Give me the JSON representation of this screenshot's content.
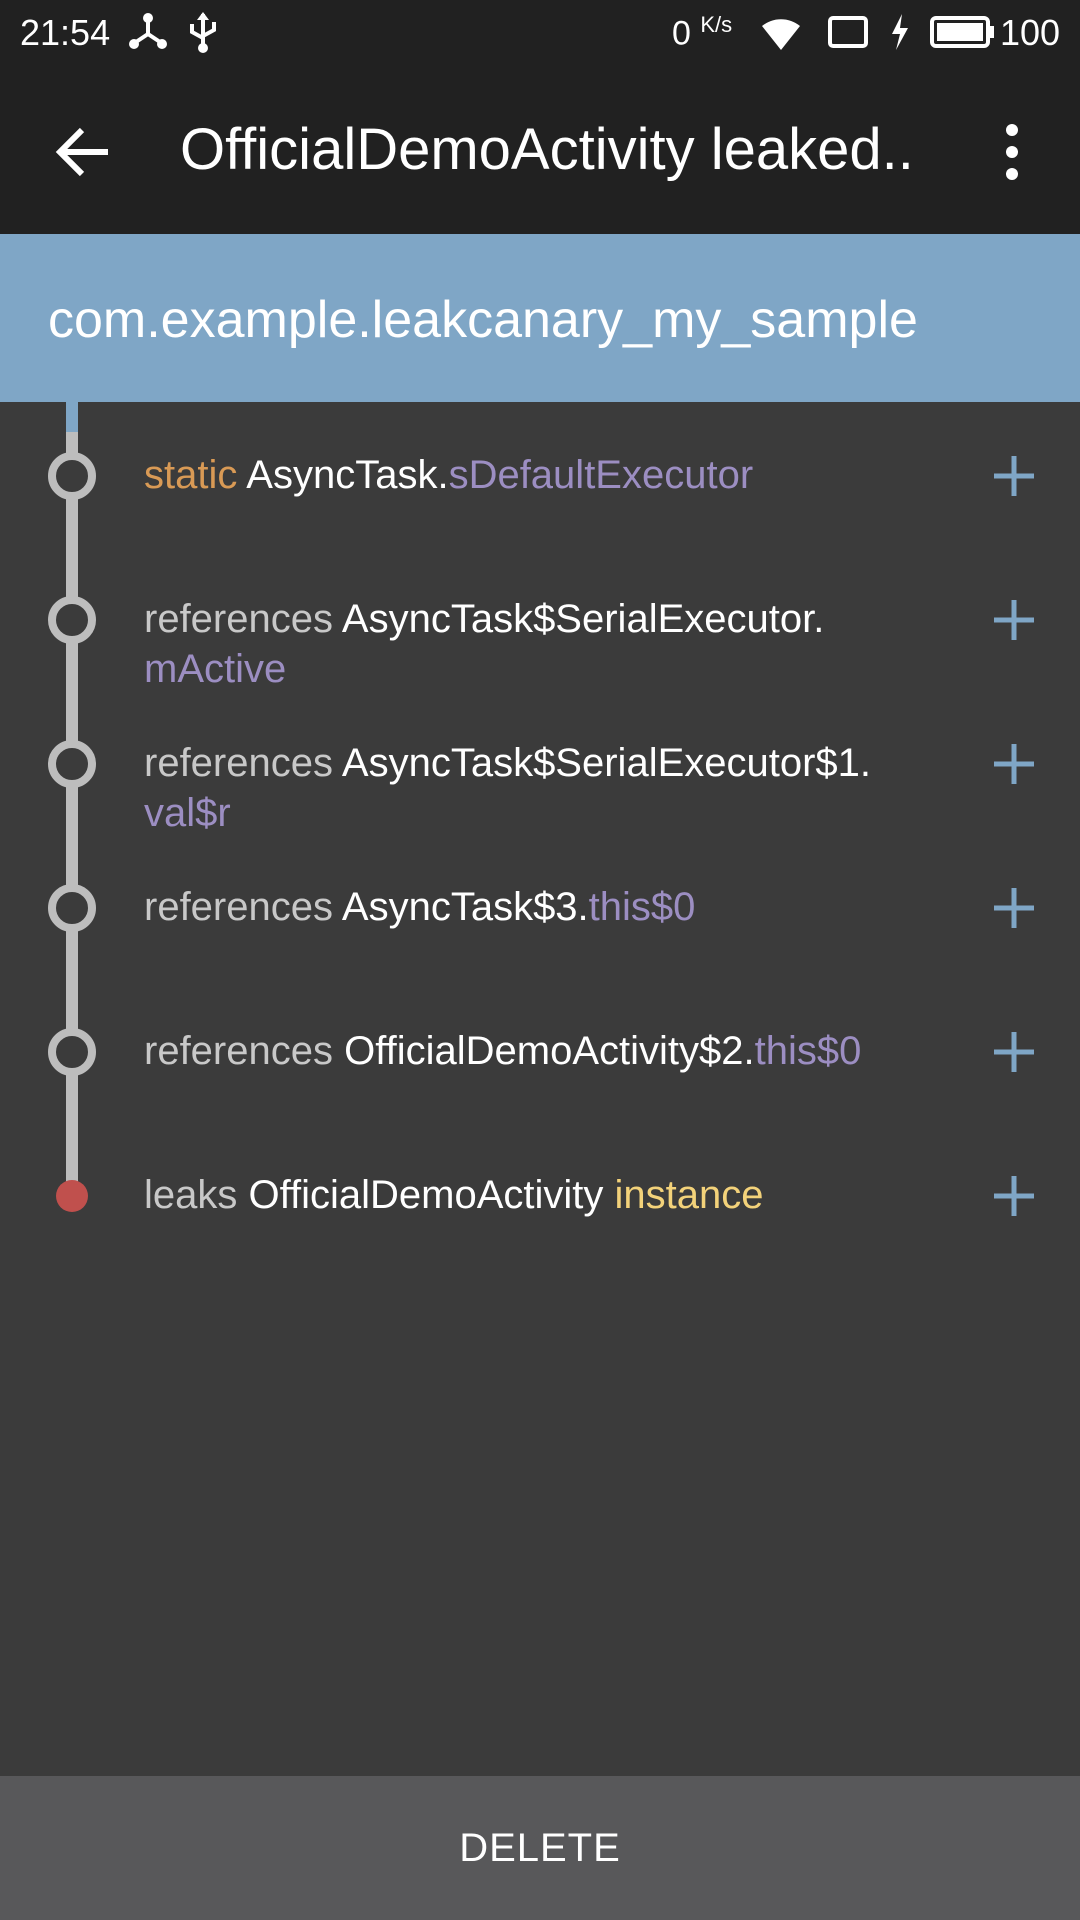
{
  "status_bar": {
    "time": "21:54",
    "net_speed_value": "0",
    "net_speed_unit": "K/s",
    "battery_level": "100",
    "icons": [
      "share-icon",
      "usb-icon",
      "wifi-icon",
      "screen-icon",
      "charging-icon",
      "battery-icon"
    ]
  },
  "app_bar": {
    "title": "OfficialDemoActivity leaked..",
    "back_icon": "arrow-back-icon",
    "menu_icon": "more-vert-icon"
  },
  "header": {
    "package_name": "com.example.leakcanary_my_sample"
  },
  "colors": {
    "background": "#3b3b3b",
    "toolbar": "#212121",
    "header": "#7fa6c6",
    "keyword": "#c8c8c8",
    "static": "#d99a55",
    "field": "#9c8ec2",
    "instance": "#f3d27a",
    "plus": "#7fa6c6",
    "leak_dot": "#c0504d",
    "timeline": "#bdbdbd"
  },
  "trace": [
    {
      "prefix": "static",
      "cls": "AsyncTask.",
      "field": "sDefaultExecutor",
      "field_on_new_line": false,
      "field_style": "field",
      "prefix_style": "static"
    },
    {
      "prefix": "references",
      "cls": "AsyncTask$SerialExecutor.",
      "field": "mActive",
      "field_on_new_line": true,
      "field_style": "field",
      "prefix_style": "kw"
    },
    {
      "prefix": "references",
      "cls": "AsyncTask$SerialExecutor$1.",
      "field": "val$r",
      "field_on_new_line": true,
      "field_style": "field",
      "prefix_style": "kw"
    },
    {
      "prefix": "references",
      "cls": "AsyncTask$3.",
      "field": "this$0",
      "field_on_new_line": false,
      "field_style": "field",
      "prefix_style": "kw"
    },
    {
      "prefix": "references",
      "cls": "OfficialDemoActivity$2.",
      "field": "this$0",
      "field_on_new_line": false,
      "field_style": "field",
      "prefix_style": "kw"
    },
    {
      "prefix": "leaks",
      "cls": "OfficialDemoActivity ",
      "field": "instance",
      "field_on_new_line": false,
      "field_style": "instance",
      "prefix_style": "kw"
    }
  ],
  "footer": {
    "delete_label": "DELETE"
  }
}
